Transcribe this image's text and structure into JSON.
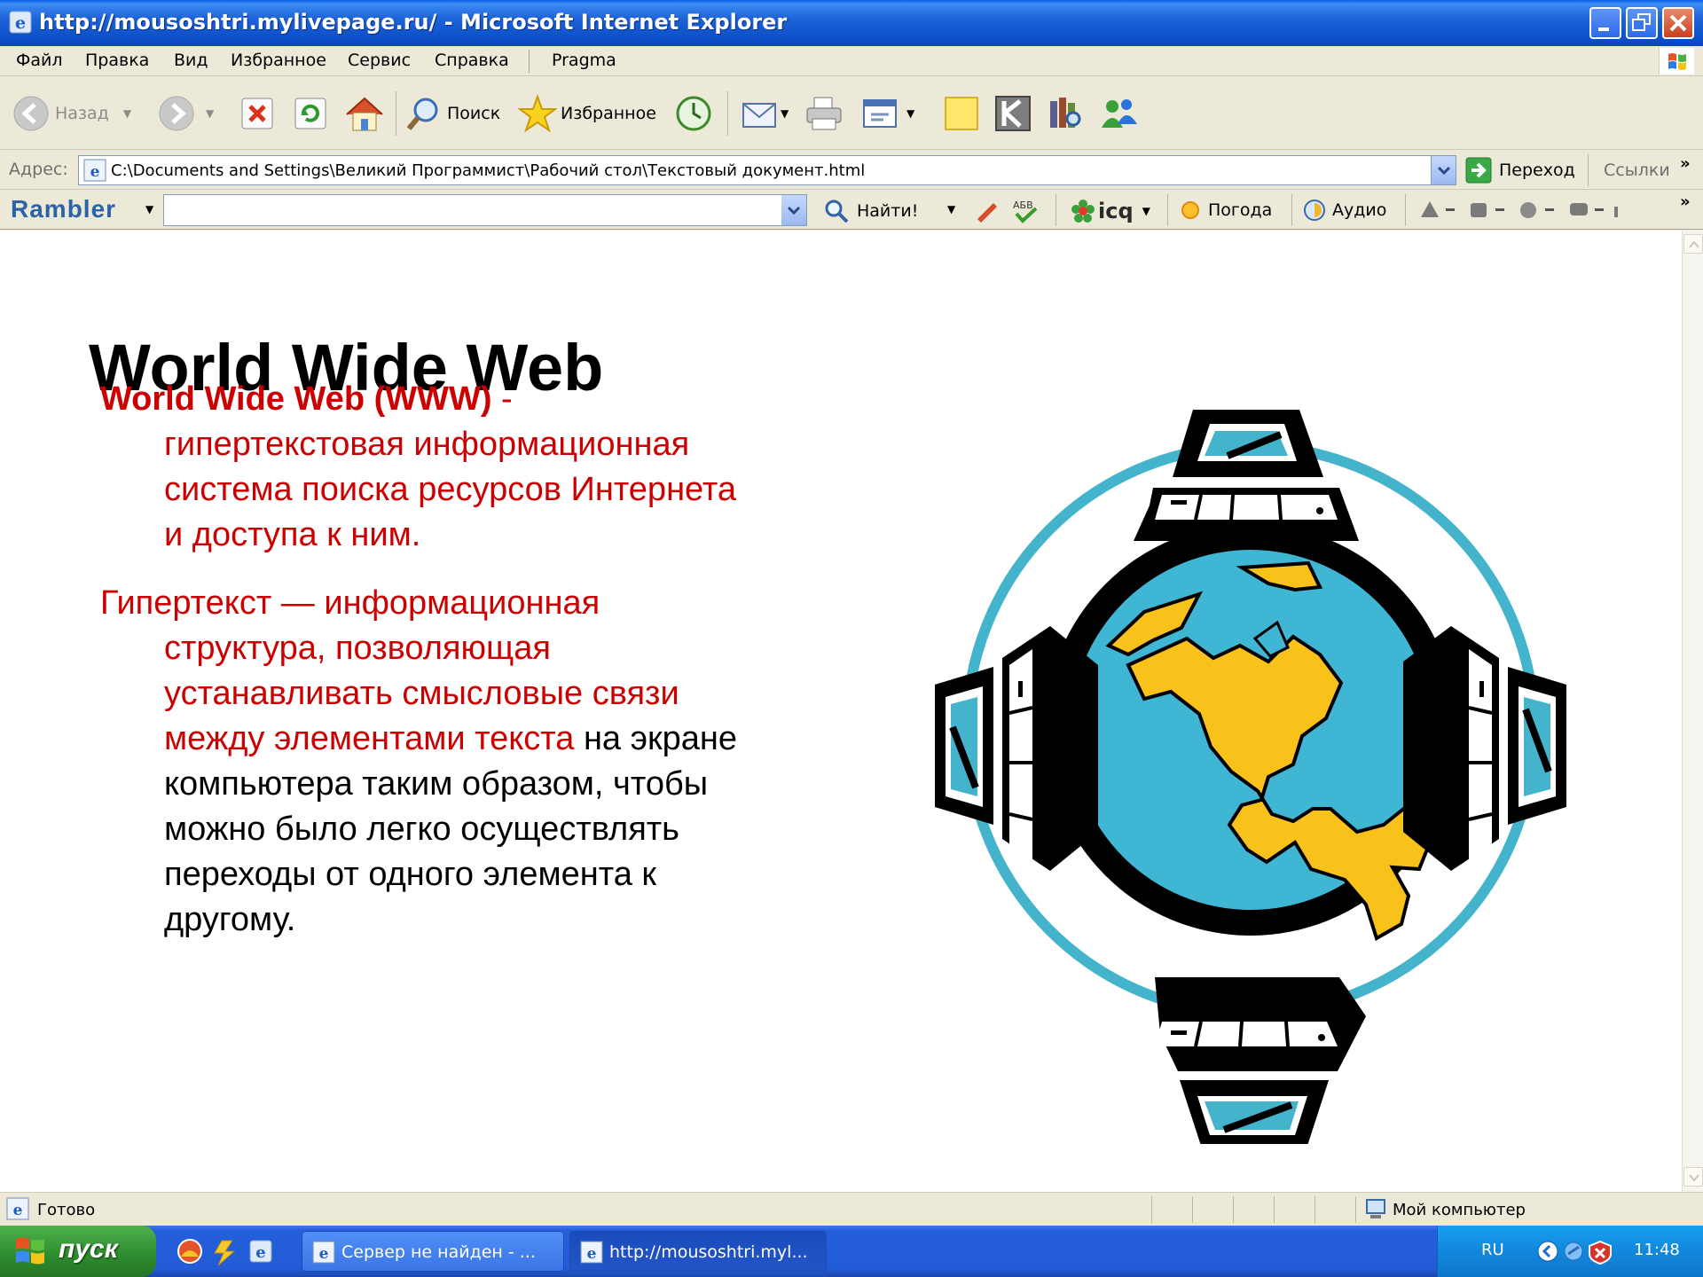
{
  "window": {
    "title": "http://mousoshtri.mylivepage.ru/ - Microsoft Internet Explorer"
  },
  "menu": [
    "Файл",
    "Правка",
    "Вид",
    "Избранное",
    "Сервис",
    "Справка",
    "Pragma"
  ],
  "toolbar": {
    "back_label": "Назад",
    "search_label": "Поиск",
    "favorites_label": "Избранное"
  },
  "address": {
    "label": "Адрес:",
    "url": "C:\\Documents and Settings\\Великий Программист\\Рабочий стол\\Текстовый документ.html",
    "go_label": "Переход",
    "links_label": "Ссылки"
  },
  "rambler": {
    "logo": "Rambler",
    "find_label": "Найти!",
    "icq_label": "icq",
    "weather_label": "Погода",
    "audio_label": "Аудио"
  },
  "slide": {
    "title": "World Wide Web",
    "p1_term": "World Wide Web (WWW)",
    "p1_dash": " -",
    "p1_lines": [
      "гипертекстовая информационная",
      "система поиска ресурсов Интернета",
      "и доступа к ним."
    ],
    "p2_first": "Гипертекст — информационная",
    "p2_red_lines": [
      "структура, позволяющая",
      "устанавливать смысловые связи"
    ],
    "p2_red_tail": "между элементами текста",
    "p2_black_tail": " на экране",
    "p2_black_lines": [
      "компьютера таким образом, чтобы",
      "можно было легко осуществлять",
      "переходы от одного элемента к",
      "другому."
    ]
  },
  "statusbar": {
    "status": "Готово",
    "zone": "Мой компьютер"
  },
  "taskbar": {
    "start_label": "пуск",
    "tasks": [
      "Сервер не найден - ...",
      "http://mousoshtri.myl..."
    ],
    "lang": "RU",
    "clock": "11:48"
  },
  "colors": {
    "accent_red": "#cc0000",
    "globe_ocean": "#3fb6d3",
    "continent": "#f8c21a",
    "ring": "#44b4cc"
  }
}
